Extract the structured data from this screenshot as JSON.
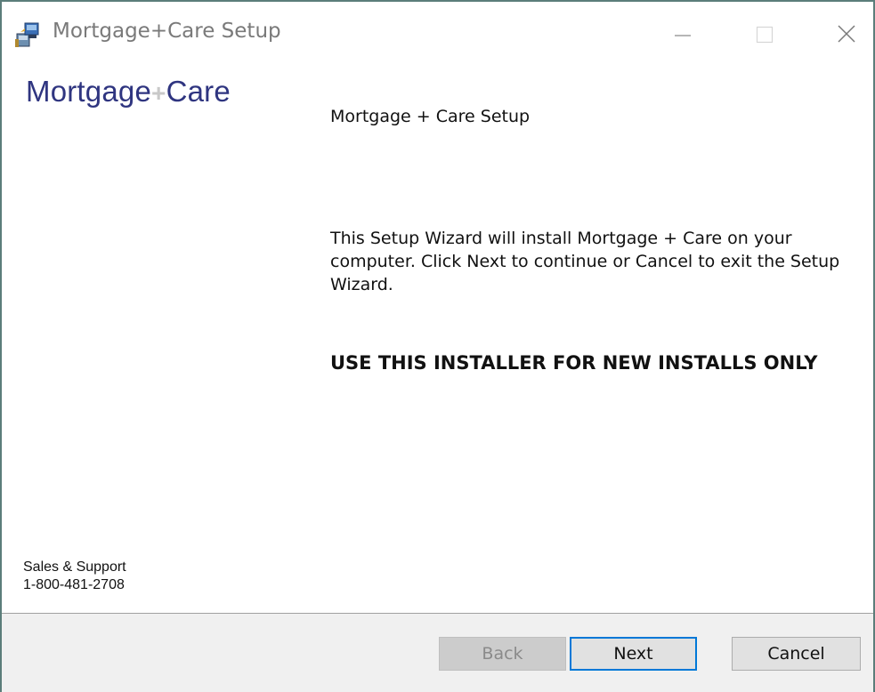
{
  "window": {
    "title": "Mortgage+Care Setup"
  },
  "logo": {
    "part1": "Mortgage",
    "plus": "+",
    "part2": "Care"
  },
  "support": {
    "label": "Sales & Support",
    "phone": "1-800-481-2708"
  },
  "content": {
    "heading": "Mortgage + Care Setup",
    "body": "This Setup Wizard will install Mortgage + Care on your computer. Click Next to continue or Cancel to exit the Setup Wizard.",
    "warning": "USE THIS INSTALLER FOR NEW INSTALLS ONLY"
  },
  "buttons": {
    "back": "Back",
    "next": "Next",
    "cancel": "Cancel"
  },
  "icons": {
    "app": "installer-icon",
    "minimize": "minimize-icon",
    "maximize": "maximize-icon",
    "close": "close-icon"
  },
  "colors": {
    "logo_text": "#2f3580",
    "logo_plus": "#c9c9c9",
    "focus_border": "#0078d7",
    "footer_bg": "#f0f0f0"
  }
}
